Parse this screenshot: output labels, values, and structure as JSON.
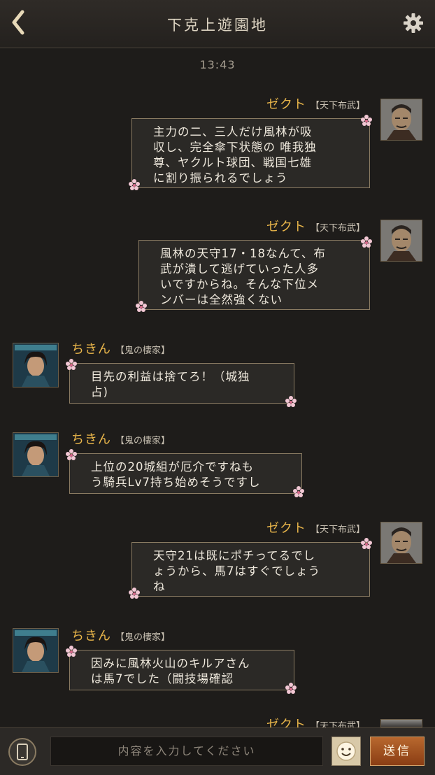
{
  "header": {
    "title": "下克上遊園地",
    "back_icon": "chevron-left-icon",
    "settings_icon": "gear-icon"
  },
  "timestamp": "13:43",
  "messages": [
    {
      "sender": "ゼクト",
      "guild": "【天下布武】",
      "side": "right",
      "text_lines": [
        "主力の二、三人だけ風林が吸",
        "収し、完全傘下状態の 唯我独",
        "尊、ヤクルト球団、戦国七雄",
        "に割り振られるでしょう"
      ]
    },
    {
      "sender": "ゼクト",
      "guild": "【天下布武】",
      "side": "right",
      "text_lines": [
        "風林の天守17・18なんて、布",
        "武が潰して逃げていった人多",
        "いですからね。そんな下位メ",
        "ンバーは全然強くない"
      ]
    },
    {
      "sender": "ちきん",
      "guild": "【鬼の棲家】",
      "side": "left",
      "text_lines": [
        "目先の利益は捨てろ！（城独",
        "占)"
      ]
    },
    {
      "sender": "ちきん",
      "guild": "【鬼の棲家】",
      "side": "left",
      "text_lines": [
        "上位の20城組が厄介ですねも",
        "う騎兵Lv7持ち始めそうですし"
      ]
    },
    {
      "sender": "ゼクト",
      "guild": "【天下布武】",
      "side": "right",
      "text_lines": [
        "天守21は既にポチってるでし",
        "ょうから、馬7はすぐでしょう",
        "ね"
      ]
    },
    {
      "sender": "ちきん",
      "guild": "【鬼の棲家】",
      "side": "left",
      "text_lines": [
        "因みに風林火山のキルアさん",
        "は馬7でした（闘技場確認"
      ]
    },
    {
      "sender": "ゼクト",
      "guild": "【天下布武】",
      "side": "right",
      "text_lines": []
    }
  ],
  "input": {
    "placeholder": "内容を入力してください"
  },
  "buttons": {
    "send_label": "送信",
    "phone_icon": "phone-icon",
    "emoji_icon": "smiley-icon"
  },
  "colors": {
    "name": "#e8b54a",
    "bubble_border": "#8a7b62",
    "background": "#1e1c1a",
    "send_button": "#a3521f"
  }
}
